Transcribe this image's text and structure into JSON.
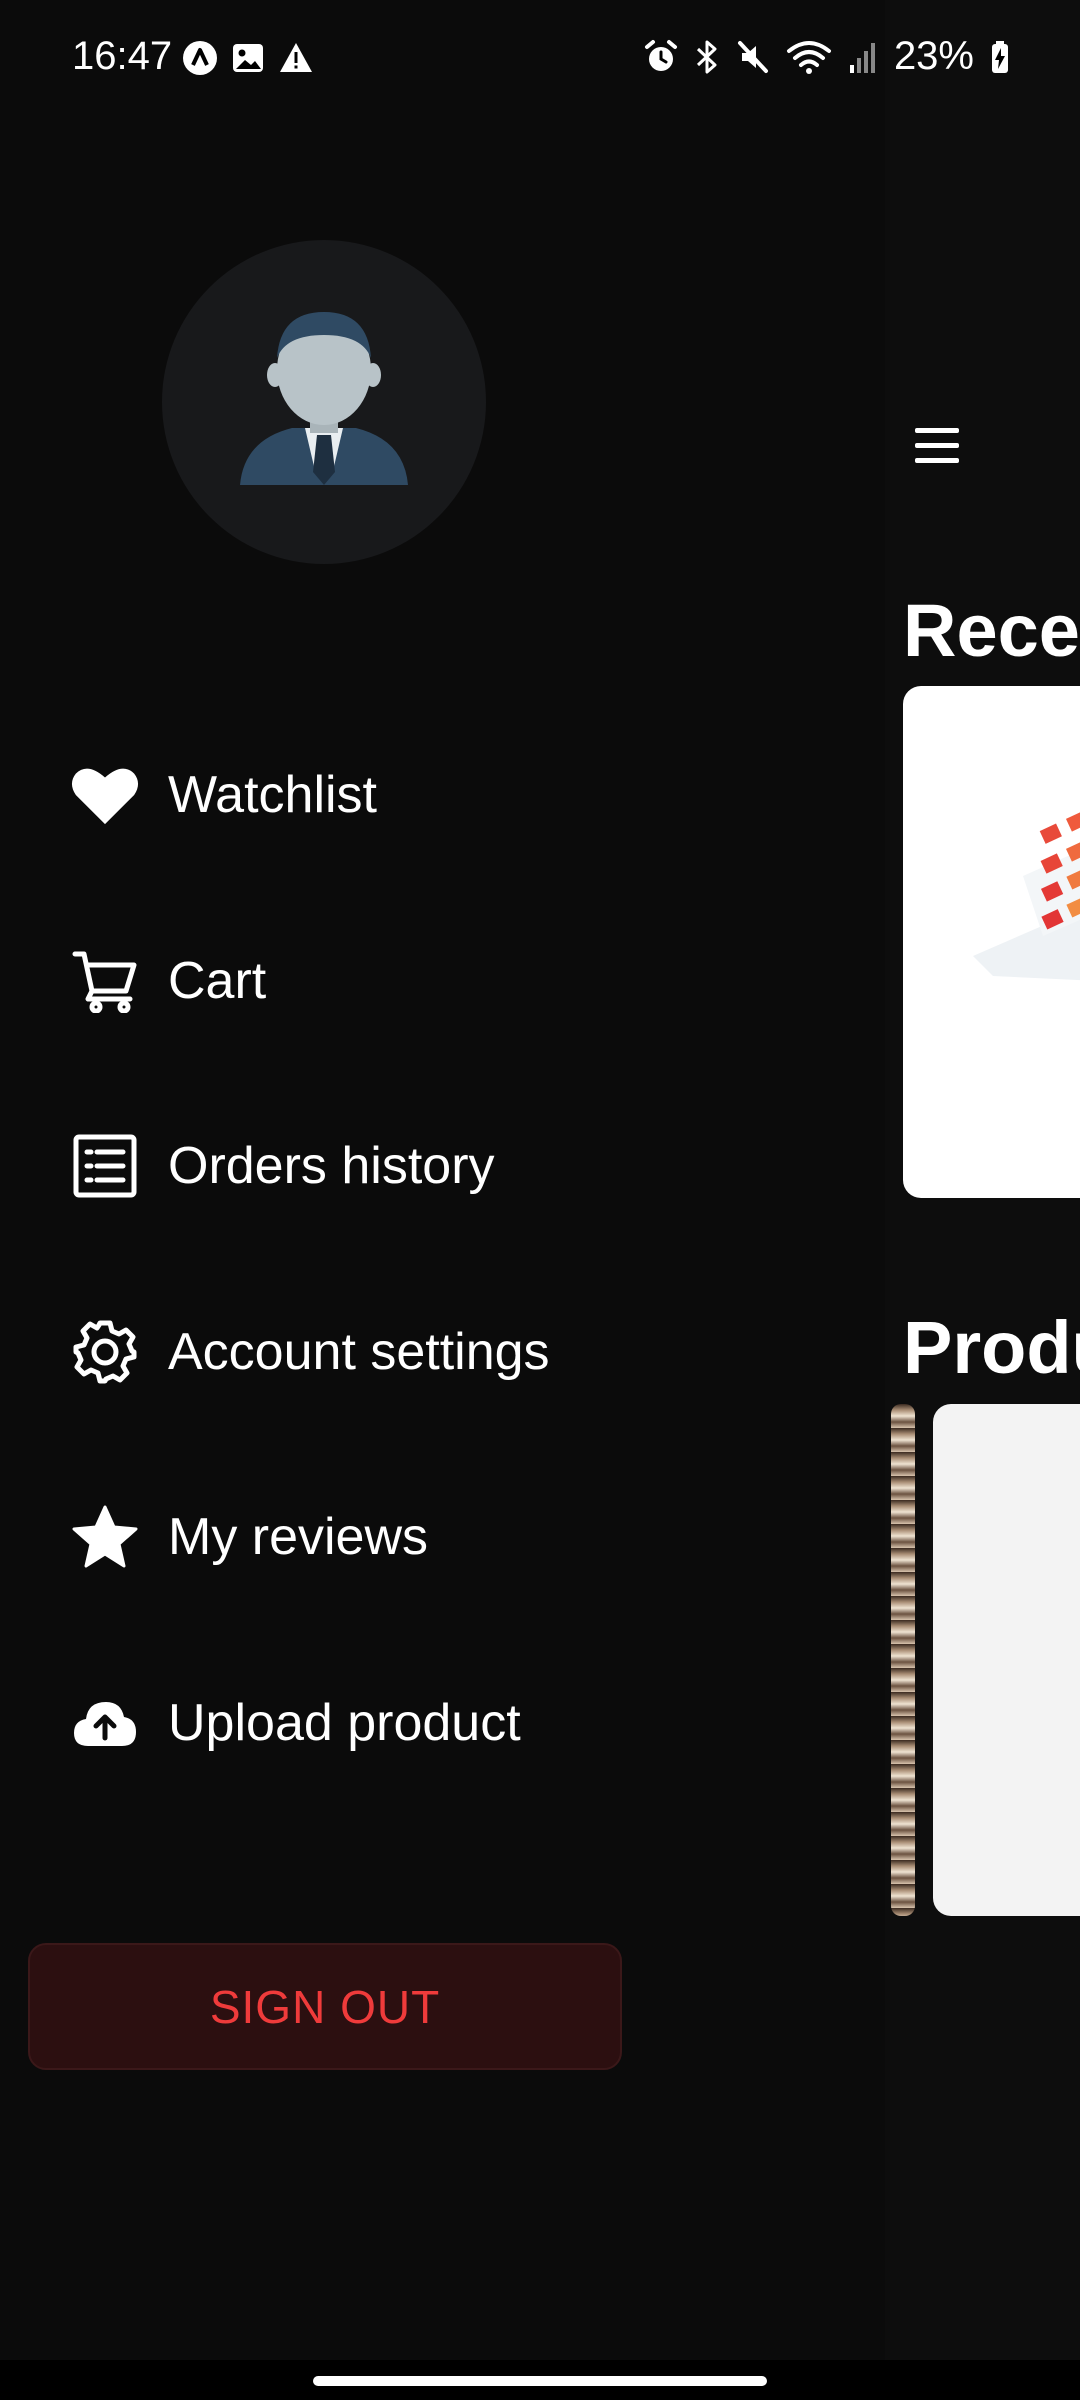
{
  "status_bar": {
    "time": "16:47",
    "battery": "23%",
    "left_icons": [
      "app-a-icon",
      "image-icon",
      "warning-icon"
    ],
    "right_icons": [
      "alarm-icon",
      "bluetooth-icon",
      "mute-icon",
      "wifi-icon",
      "signal-icon",
      "battery-icon"
    ]
  },
  "drawer": {
    "avatar": "avatar-icon",
    "menu": [
      {
        "label": "Watchlist",
        "icon": "heart-icon"
      },
      {
        "label": "Cart",
        "icon": "cart-icon"
      },
      {
        "label": "Orders history",
        "icon": "list-icon"
      },
      {
        "label": "Account settings",
        "icon": "gear-icon"
      },
      {
        "label": "My reviews",
        "icon": "star-icon"
      },
      {
        "label": "Upload product",
        "icon": "cloud-upload-icon"
      }
    ],
    "sign_out_label": "SIGN OUT"
  },
  "main": {
    "section1_title": "Recen",
    "section2_title": "Produ"
  },
  "colors": {
    "background": "#0b0b0b",
    "sign_out_text": "#ef3b3b",
    "sign_out_bg": "#2c0f10"
  }
}
